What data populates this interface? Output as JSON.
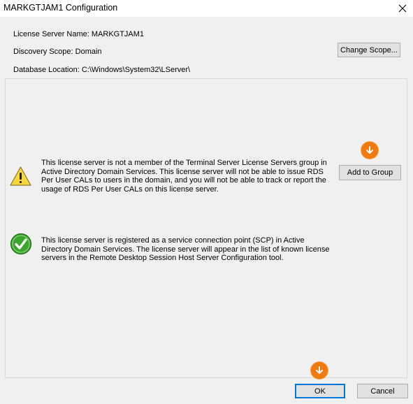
{
  "window": {
    "title": "MARKGTJAM1 Configuration",
    "close_icon": "close-icon"
  },
  "info": {
    "license_server_name": "License Server Name: MARKGTJAM1",
    "discovery_scope": "Discovery Scope: Domain",
    "database_location": "Database Location: C:\\Windows\\System32\\LServer\\",
    "change_scope_label": "Change Scope..."
  },
  "warning": {
    "icon": "warning-icon",
    "text": "This license server is not a member of the Terminal Server License Servers group in Active Directory Domain Services. This license server will not be able to issue RDS Per User CALs to users in the domain, and you will not be able to track or report the usage of RDS Per User CALs on this license server.",
    "button_label": "Add to Group"
  },
  "success": {
    "icon": "checkmark-icon",
    "text": "This license server is registered as a service connection point (SCP) in Active Directory Domain Services. The license server will appear in the list of known license servers in the Remote Desktop Session Host Server Configuration tool."
  },
  "footer": {
    "ok_label": "OK",
    "cancel_label": "Cancel"
  },
  "colors": {
    "accent": "#0078d7",
    "highlight_badge": "#f07a10",
    "warning": "#f2c200",
    "success": "#3aa52b"
  }
}
